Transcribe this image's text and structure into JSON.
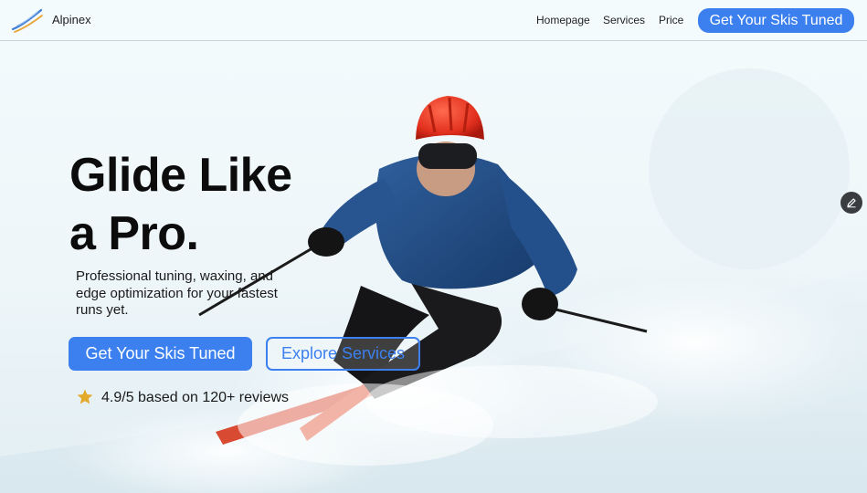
{
  "header": {
    "brand": "Alpinex",
    "nav": [
      {
        "label": "Homepage"
      },
      {
        "label": "Services"
      },
      {
        "label": "Price"
      }
    ],
    "cta_label": "Get Your Skis Tuned"
  },
  "hero": {
    "headline": "Glide Like\na Pro.",
    "subtext": "Professional tuning, waxing, and edge optimization for your fastest runs yet.",
    "primary_cta": "Get Your Skis Tuned",
    "secondary_cta": "Explore Services",
    "rating_text": "4.9/5 based on 120+ reviews",
    "rating_icon": "star-icon",
    "image": "skier-image",
    "edit_icon": "pencil-icon"
  },
  "colors": {
    "accent": "#3b80ee",
    "star": "#e3a92b",
    "text": "#0c0c0c",
    "fab": "#3a3d40"
  }
}
